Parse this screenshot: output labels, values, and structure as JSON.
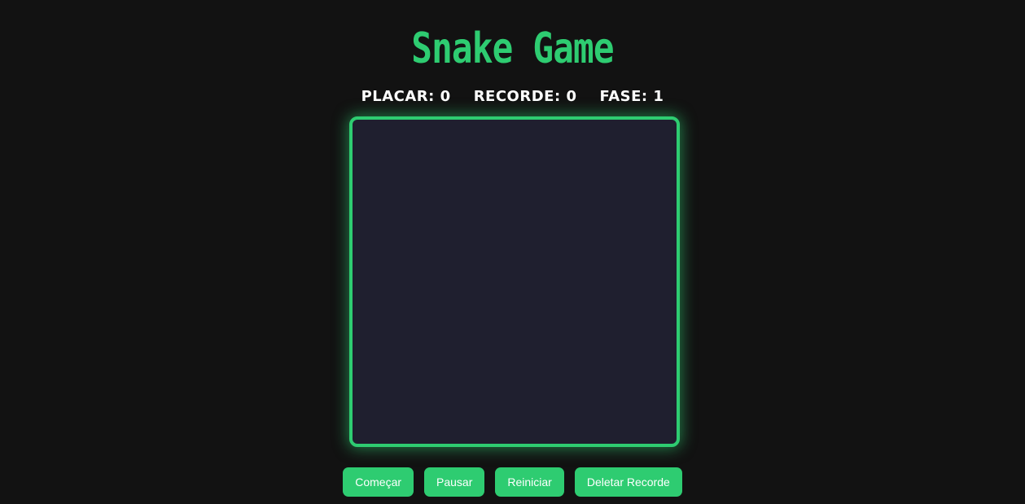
{
  "title": "Snake Game",
  "stats": {
    "score_label": "PLACAR:",
    "score_value": "0",
    "record_label": "RECORDE:",
    "record_value": "0",
    "level_label": "FASE:",
    "level_value": "1"
  },
  "controls": {
    "start_label": "Começar",
    "pause_label": "Pausar",
    "restart_label": "Reiniciar",
    "delete_record_label": "Deletar Recorde"
  },
  "colors": {
    "accent": "#2ecc71",
    "background": "#121212",
    "board": "#1f1f2f",
    "text": "#ffffff"
  }
}
